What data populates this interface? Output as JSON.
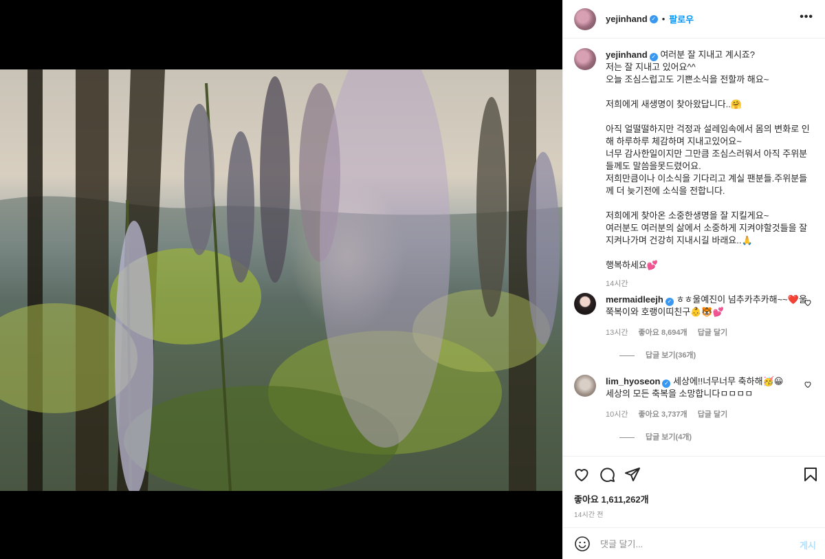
{
  "post": {
    "author": "yejinhand",
    "follow_label": "팔로우",
    "dot": "•",
    "more_label": "•••",
    "caption": "여러분 잘 지내고 계시죠?\n저는 잘 지내고 있어요^^\n오늘 조심스럽고도 기쁜소식을 전할까 해요~\n\n저희에게 새생명이 찾아왔답니다..🤗\n\n아직 얼떨떨하지만 걱정과 설레임속에서 몸의 변화로 인해 하루하루 체감하며 지내고있어요~\n너무 감사한일이지만 그만큼 조심스러워서 아직 주위분들께도 말씀을못드렸어요.\n저희만큼이나 이소식을 기다리고 계실 팬분들.주위분들께 더 늦기전에 소식을 전합니다.\n\n저희에게 찾아온 소중한생명을 잘 지킬게요~\n여러분도 여러분의 삶에서 소중하게 지켜야할것들을 잘지켜나가며 건강히 지내시길 바래요..🙏\n\n행복하세요💕",
    "caption_time": "14시간",
    "likes": "좋아요 1,611,262개",
    "time_ago": "14시간 전"
  },
  "comments": [
    {
      "user": "mermaidleejh",
      "text": "ㅎㅎ울예진이 넘추카추카해~~❤️울쭉복이와 호랭이띠친구👶🐯💕",
      "time": "13시간",
      "likes": "좋아요 8,694개",
      "reply_label": "답글 달기",
      "view_replies": "답글 보기(36개)"
    },
    {
      "user": "lim_hyoseon",
      "text": "세상에!!너무너무 축하해🥳😀\n세상의 모든 축복을 소망합니다ㅁㅁㅁㅁ",
      "time": "10시간",
      "likes": "좋아요 3,737개",
      "reply_label": "답글 달기",
      "view_replies": "답글 보기(4개)"
    }
  ],
  "composer": {
    "placeholder": "댓글 달기...",
    "post_label": "게시"
  },
  "icons": {
    "like": "heart-icon",
    "comment": "comment-icon",
    "share": "send-icon",
    "save": "bookmark-icon",
    "emoji": "emoji-icon"
  },
  "colors": {
    "link_blue": "#0095f6",
    "verified_blue": "#3897f0",
    "muted": "#8e8e8e",
    "divider": "#efefef"
  }
}
